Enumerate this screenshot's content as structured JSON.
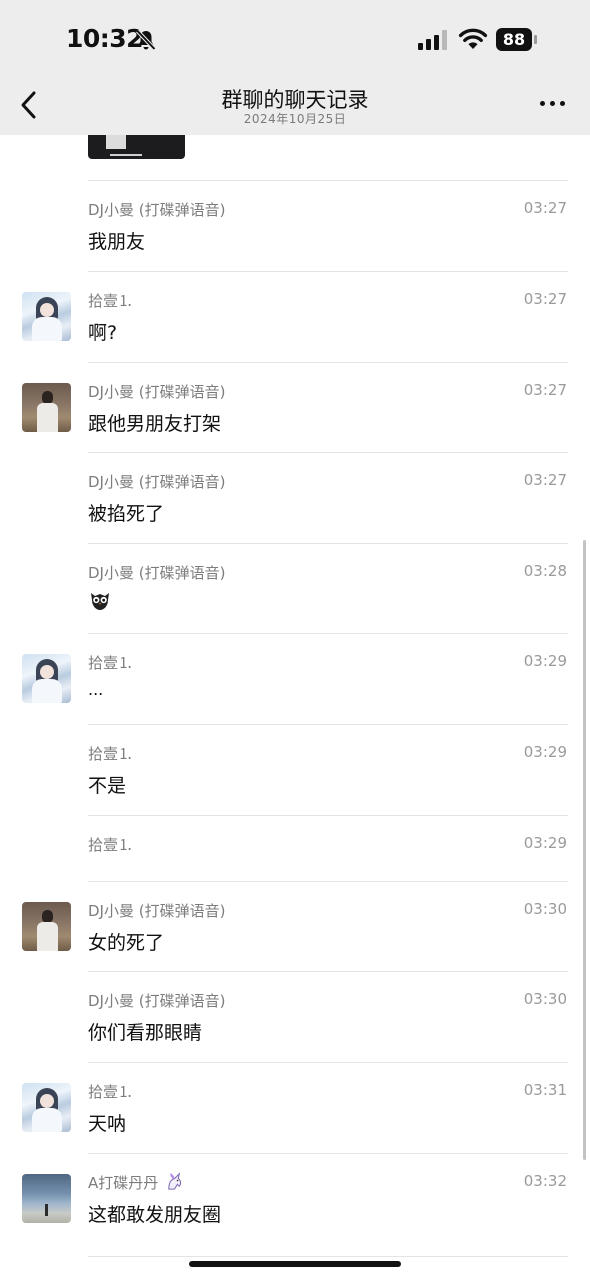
{
  "status_bar": {
    "time": "10:32",
    "battery": "88"
  },
  "nav": {
    "title": "群聊的聊天记录",
    "date": "2024年10月25日"
  },
  "messages": [
    {
      "sender": "DJ小曼 (打碟弹语音)",
      "time": "03:27",
      "text": "我朋友"
    },
    {
      "sender": "拾壹⒈",
      "time": "03:27",
      "text": "啊?"
    },
    {
      "sender": "DJ小曼 (打碟弹语音)",
      "time": "03:27",
      "text": "跟他男朋友打架"
    },
    {
      "sender": "DJ小曼 (打碟弹语音)",
      "time": "03:27",
      "text": "被掐死了"
    },
    {
      "sender": "DJ小曼 (打碟弹语音)",
      "time": "03:28",
      "text": ""
    },
    {
      "sender": "拾壹⒈",
      "time": "03:29",
      "text": "..."
    },
    {
      "sender": "拾壹⒈",
      "time": "03:29",
      "text": "不是"
    },
    {
      "sender": "拾壹⒈",
      "time": "03:29",
      "text": ""
    },
    {
      "sender": "DJ小曼 (打碟弹语音)",
      "time": "03:30",
      "text": "女的死了"
    },
    {
      "sender": "DJ小曼 (打碟弹语音)",
      "time": "03:30",
      "text": "你们看那眼睛"
    },
    {
      "sender": "拾壹⒈",
      "time": "03:31",
      "text": "天呐"
    },
    {
      "sender": "A打碟丹丹",
      "time": "03:32",
      "text": "这都敢发朋友圈"
    }
  ],
  "icons": {
    "bell": "bell-slash-icon",
    "back": "chevron-left-icon",
    "more": "more-dots-icon",
    "sticker": "owl-emoji-icon",
    "unicorn": "unicorn-emoji-icon"
  }
}
